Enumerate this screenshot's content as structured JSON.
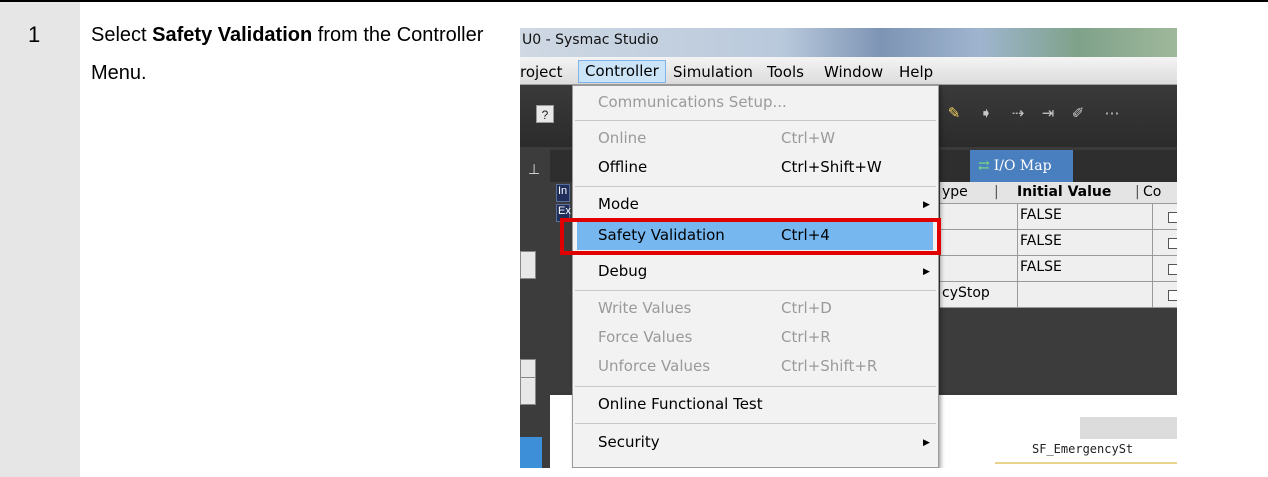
{
  "step": {
    "number": "1",
    "instruction_prefix": "Select ",
    "instruction_bold": "Safety Validation",
    "instruction_suffix": " from the Controller Menu."
  },
  "window": {
    "title": "U0 - Sysmac Studio"
  },
  "menubar": {
    "items": [
      "roject",
      "Controller",
      "Simulation",
      "Tools",
      "Window",
      "Help"
    ]
  },
  "toolbar": {
    "help_icon": "?"
  },
  "tab": {
    "label": "I/O Map"
  },
  "grid": {
    "headers": {
      "type": "ype",
      "initial_value": "Initial Value",
      "next": "Co"
    },
    "rows": [
      {
        "type": "",
        "initial_value": "FALSE"
      },
      {
        "type": "",
        "initial_value": "FALSE"
      },
      {
        "type": "",
        "initial_value": "FALSE"
      },
      {
        "type": "cyStop",
        "initial_value": ""
      }
    ],
    "markers": [
      "In",
      "Ex"
    ]
  },
  "code": {
    "label": "SF_EmergencySt"
  },
  "menu": {
    "items": [
      {
        "label": "Communications Setup...",
        "shortcut": "",
        "enabled": false
      },
      {
        "label": "Online",
        "shortcut": "Ctrl+W",
        "enabled": false
      },
      {
        "label": "Offline",
        "shortcut": "Ctrl+Shift+W",
        "enabled": true
      },
      {
        "label": "Mode",
        "shortcut": "",
        "enabled": true,
        "submenu": true
      },
      {
        "label": "Safety Validation",
        "shortcut": "Ctrl+4",
        "enabled": true,
        "highlighted": true
      },
      {
        "label": "Debug",
        "shortcut": "",
        "enabled": true,
        "submenu": true
      },
      {
        "label": "Write Values",
        "shortcut": "Ctrl+D",
        "enabled": false
      },
      {
        "label": "Force Values",
        "shortcut": "Ctrl+R",
        "enabled": false
      },
      {
        "label": "Unforce Values",
        "shortcut": "Ctrl+Shift+R",
        "enabled": false
      },
      {
        "label": "Online Functional Test",
        "shortcut": "",
        "enabled": true
      },
      {
        "label": "Security",
        "shortcut": "",
        "enabled": true,
        "submenu": true
      }
    ]
  },
  "colors": {
    "highlight": "#77b7ef",
    "annotation_red": "#e00000",
    "tab_blue": "#4a7fbf"
  }
}
